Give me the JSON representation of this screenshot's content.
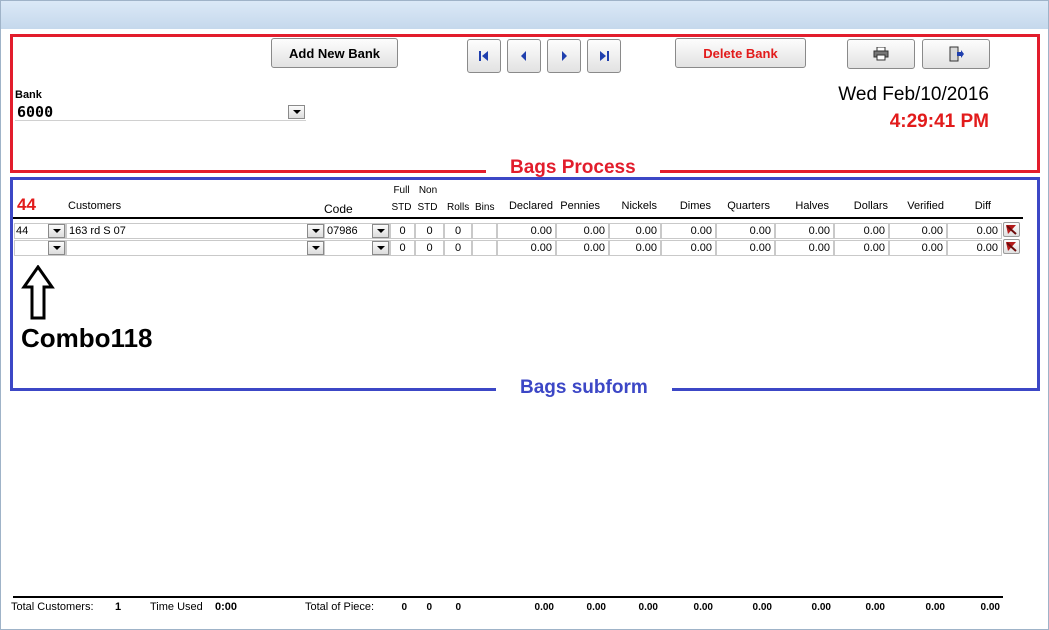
{
  "toolbar": {
    "add_new_bank": "Add New Bank",
    "delete_bank": "Delete Bank"
  },
  "bank": {
    "label": "Bank",
    "value": "6000"
  },
  "datetime": {
    "date": "Wed Feb/10/2016",
    "time": "4:29:41 PM"
  },
  "sections": {
    "process_label": "Bags Process",
    "subform_label": "Bags subform"
  },
  "subform": {
    "count": "44",
    "headers": {
      "customers": "Customers",
      "code": "Code",
      "full_top": "Full",
      "full_bottom": "STD",
      "non_top": "Non",
      "non_bottom": "STD",
      "rolls": "Rolls",
      "bins": "Bins",
      "declared": "Declared",
      "pennies": "Pennies",
      "nickels": "Nickels",
      "dimes": "Dimes",
      "quarters": "Quarters",
      "halves": "Halves",
      "dollars": "Dollars",
      "verified": "Verified",
      "diff": "Diff"
    },
    "rows": [
      {
        "combo": "44",
        "customer": "163 rd S 07",
        "code": "07986",
        "full": "0",
        "non": "0",
        "rolls": "0",
        "bins": "",
        "declared": "0.00",
        "pennies": "0.00",
        "nickels": "0.00",
        "dimes": "0.00",
        "quarters": "0.00",
        "halves": "0.00",
        "dollars": "0.00",
        "verified": "0.00",
        "diff": "0.00"
      },
      {
        "combo": "",
        "customer": "",
        "code": "",
        "full": "0",
        "non": "0",
        "rolls": "0",
        "bins": "",
        "declared": "0.00",
        "pennies": "0.00",
        "nickels": "0.00",
        "dimes": "0.00",
        "quarters": "0.00",
        "halves": "0.00",
        "dollars": "0.00",
        "verified": "0.00",
        "diff": "0.00"
      }
    ]
  },
  "annotation": {
    "label": "Combo118"
  },
  "footer": {
    "total_customers_label": "Total Customers:",
    "total_customers_value": "1",
    "time_used_label": "Time Used",
    "time_used_value": "0:00",
    "total_piece_label": "Total of Piece:",
    "full": "0",
    "non": "0",
    "rolls": "0",
    "declared": "0.00",
    "pennies": "0.00",
    "nickels": "0.00",
    "dimes": "0.00",
    "quarters": "0.00",
    "halves": "0.00",
    "dollars": "0.00",
    "verified": "0.00",
    "diff": "0.00"
  },
  "icons": {
    "first": "first-record-icon",
    "prev": "previous-record-icon",
    "next": "next-record-icon",
    "last": "last-record-icon",
    "print": "printer-icon",
    "exit": "exit-door-icon",
    "delete_row": "delete-row-icon"
  },
  "colors": {
    "process_border": "#e21d2c",
    "subform_border": "#3c47c6",
    "accent_red": "#e21b1b",
    "nav_blue": "#1f3fae"
  }
}
